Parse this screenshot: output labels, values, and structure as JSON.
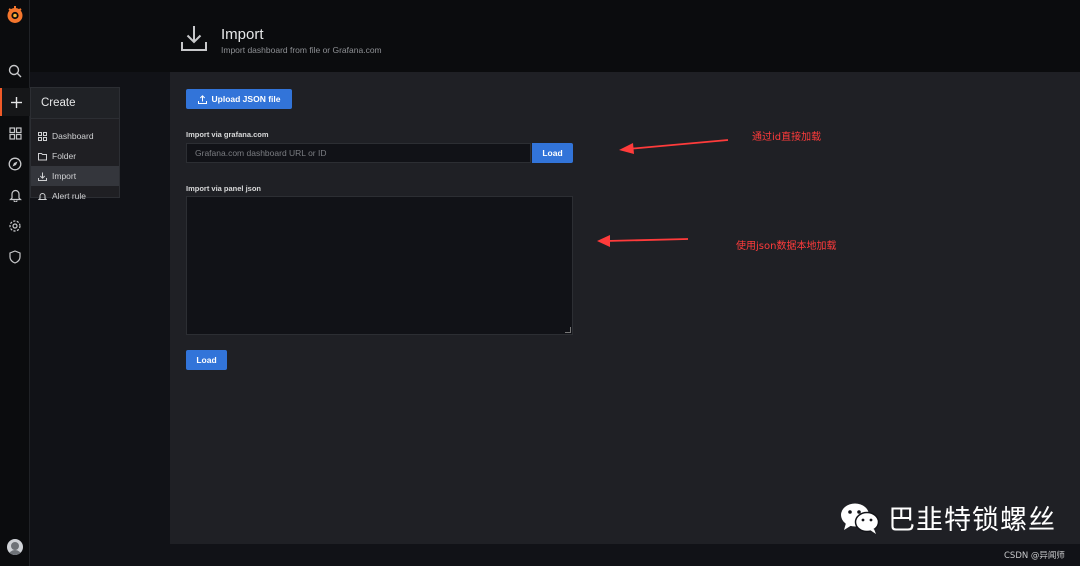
{
  "sidebar": {
    "logo_icon": "grafana-logo-icon",
    "items": [
      {
        "name": "search-icon"
      },
      {
        "name": "create-plus-icon"
      },
      {
        "name": "dashboards-grid-icon"
      },
      {
        "name": "explore-compass-icon"
      },
      {
        "name": "alerting-bell-icon"
      },
      {
        "name": "configuration-gear-icon"
      },
      {
        "name": "server-admin-shield-icon"
      }
    ],
    "avatar_icon": "user-avatar-icon",
    "accent_color": "#f05a28"
  },
  "create_menu": {
    "title": "Create",
    "items": [
      {
        "label": "Dashboard",
        "icon": "apps-grid-icon"
      },
      {
        "label": "Folder",
        "icon": "folder-plus-icon"
      },
      {
        "label": "Import",
        "icon": "import-icon",
        "active": true
      },
      {
        "label": "Alert rule",
        "icon": "bell-icon"
      }
    ]
  },
  "header": {
    "title": "Import",
    "subtitle": "Import dashboard from file or Grafana.com",
    "icon": "download-icon"
  },
  "upload": {
    "label": "Upload JSON file",
    "icon": "upload-icon"
  },
  "grafana_import": {
    "label": "Import via grafana.com",
    "placeholder": "Grafana.com dashboard URL or ID",
    "button": "Load"
  },
  "panel_json": {
    "label": "Import via panel json",
    "button": "Load"
  },
  "annotations": {
    "by_id": "通过id直接加载",
    "by_json": "使用json数据本地加载",
    "color": "#ff3b3b"
  },
  "watermark": {
    "text": "巴韭特锁螺丝",
    "icon": "wechat-icon",
    "credit": "CSDN @异闻师"
  },
  "colors": {
    "primary_button": "#3274d9",
    "background": "#111217",
    "panel": "#1f2025"
  }
}
